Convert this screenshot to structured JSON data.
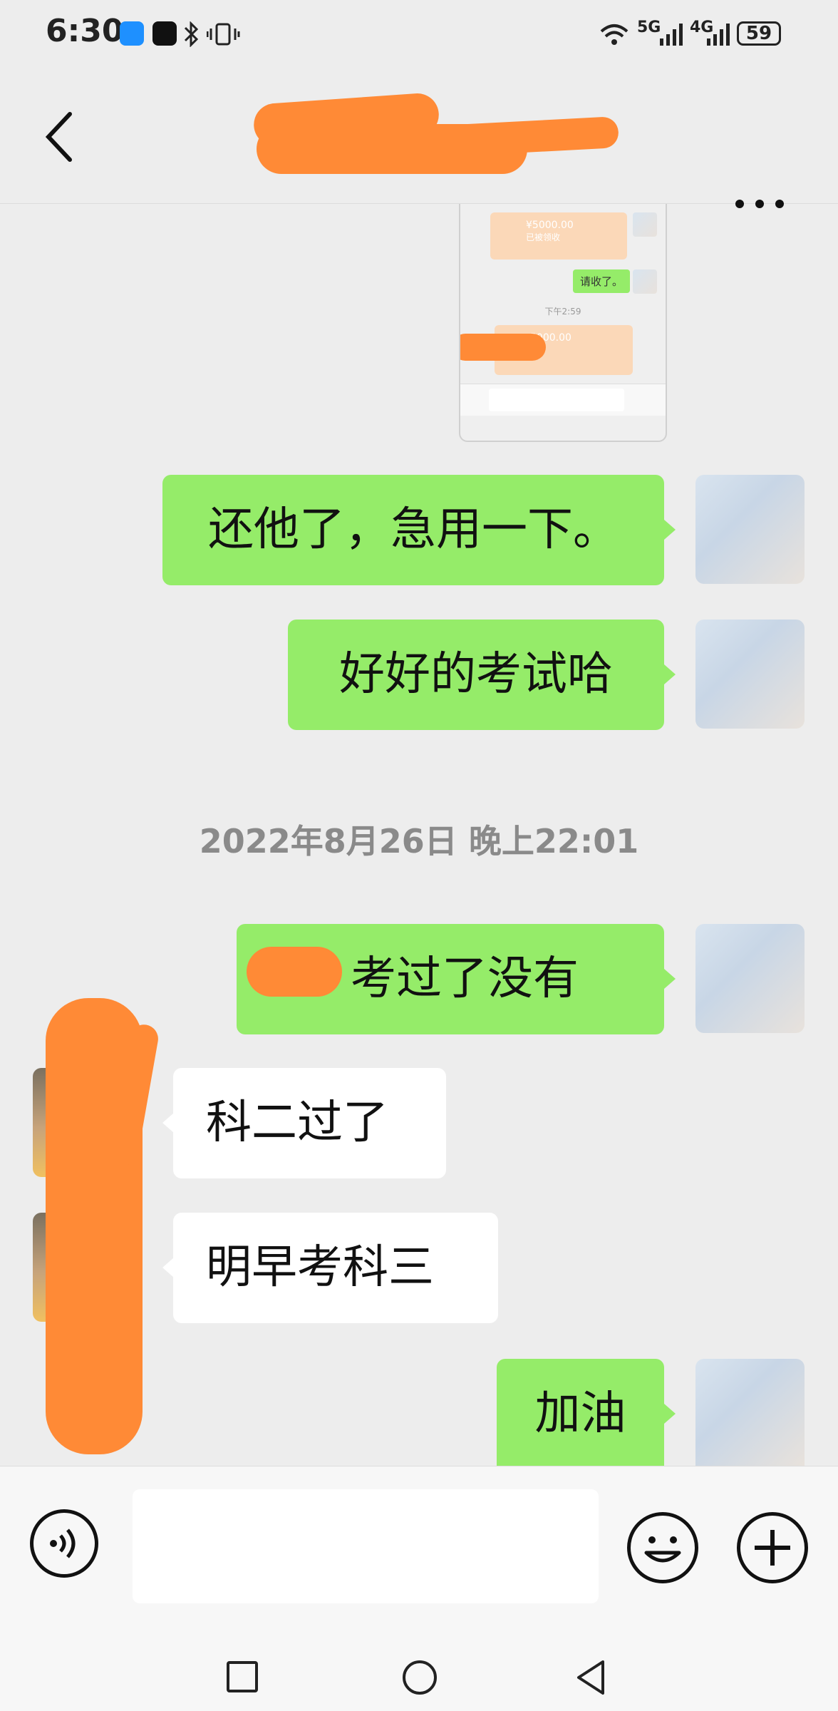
{
  "status_bar": {
    "time": "6:30",
    "network_1": "5G",
    "network_2": "4G",
    "battery": "59"
  },
  "header": {
    "back_icon": "chevron-left-icon",
    "title": "",
    "more_label": "···"
  },
  "embedded_screenshot": {
    "transfer_1_amount": "¥5000.00",
    "transfer_1_status": "已被领收",
    "message": "请收了。",
    "time": "下午2:59",
    "transfer_2_amount": "5000.00"
  },
  "messages": [
    {
      "side": "right",
      "text": "还他了，急用一下。"
    },
    {
      "side": "right",
      "text": "好好的考试哈"
    },
    {
      "side": "right",
      "text": "考过了没有"
    },
    {
      "side": "left",
      "text": "科二过了"
    },
    {
      "side": "left",
      "text": "明早考科三"
    },
    {
      "side": "right",
      "text": "加油"
    }
  ],
  "timestamp": "2022年8月26日 晚上22:01",
  "input_bar": {
    "voice_icon": "voice-icon",
    "emoji_icon": "emoji-icon",
    "plus_icon": "plus-icon",
    "input_value": ""
  },
  "nav_bar": {
    "recent_icon": "square-icon",
    "home_icon": "circle-icon",
    "back_icon": "triangle-back-icon"
  },
  "colors": {
    "background": "#ededed",
    "bubble_green": "#95ec69",
    "bubble_white": "#ffffff",
    "redaction": "#ff8a36"
  }
}
